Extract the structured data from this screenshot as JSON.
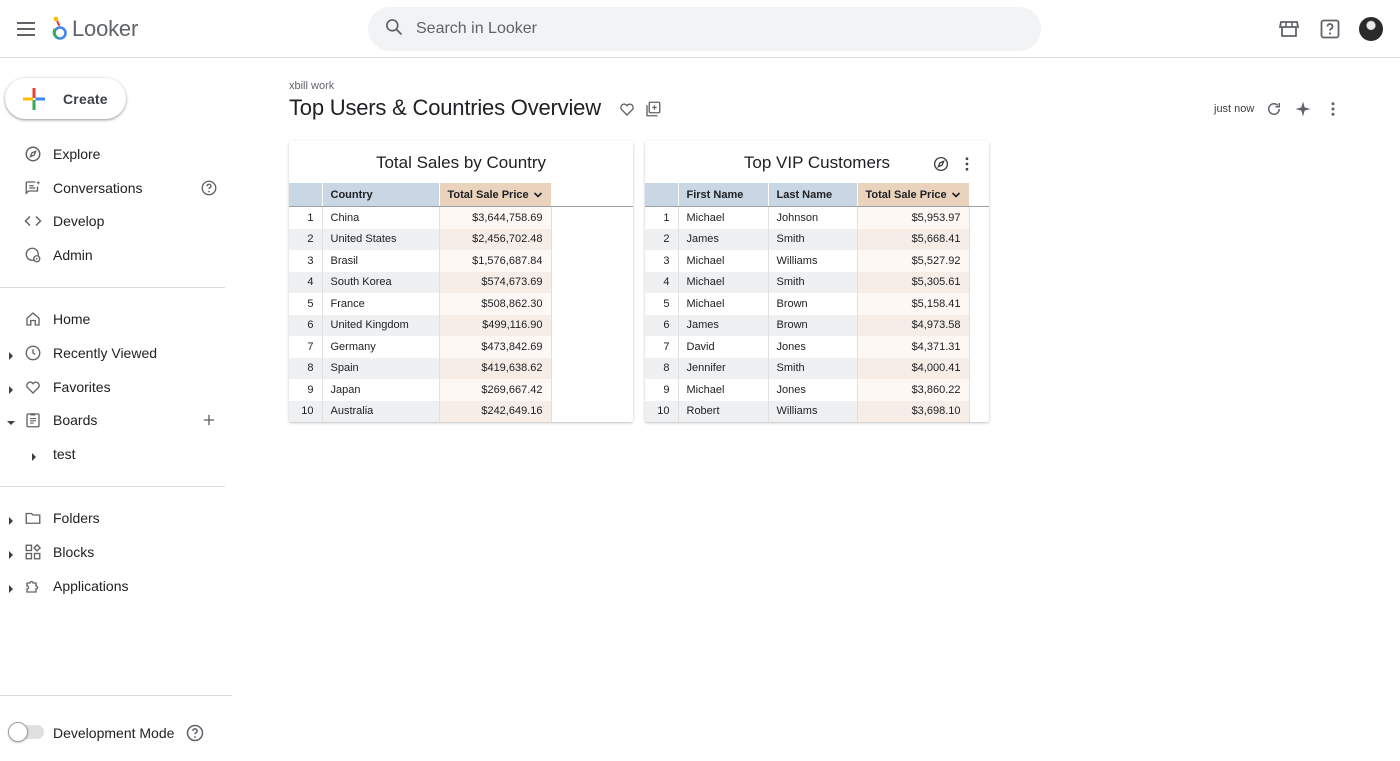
{
  "app": {
    "brand": "Looker",
    "search_placeholder": "Search in Looker"
  },
  "sidebar": {
    "create_label": "Create",
    "primary": [
      {
        "label": "Explore",
        "icon": "compass-icon"
      },
      {
        "label": "Conversations",
        "icon": "conversations-icon"
      },
      {
        "label": "Develop",
        "icon": "code-icon"
      },
      {
        "label": "Admin",
        "icon": "admin-icon"
      }
    ],
    "content": [
      {
        "label": "Home",
        "icon": "home-icon"
      },
      {
        "label": "Recently Viewed",
        "icon": "clock-icon"
      },
      {
        "label": "Favorites",
        "icon": "heart-icon"
      },
      {
        "label": "Boards",
        "icon": "board-icon"
      },
      {
        "label": "test",
        "icon": "caret-right-icon"
      }
    ],
    "library": [
      {
        "label": "Folders",
        "icon": "folder-icon"
      },
      {
        "label": "Blocks",
        "icon": "blocks-icon"
      },
      {
        "label": "Applications",
        "icon": "puzzle-icon"
      }
    ],
    "dev_mode_label": "Development Mode",
    "dev_mode_on": false
  },
  "dashboard": {
    "folder": "xbill work",
    "title": "Top Users & Countries Overview",
    "refreshed": "just now"
  },
  "tiles": {
    "sales": {
      "title": "Total Sales by Country",
      "columns": [
        "Country",
        "Total Sale Price"
      ],
      "rows": [
        [
          "1",
          "China",
          "$3,644,758.69"
        ],
        [
          "2",
          "United States",
          "$2,456,702.48"
        ],
        [
          "3",
          "Brasil",
          "$1,576,687.84"
        ],
        [
          "4",
          "South Korea",
          "$574,673.69"
        ],
        [
          "5",
          "France",
          "$508,862.30"
        ],
        [
          "6",
          "United Kingdom",
          "$499,116.90"
        ],
        [
          "7",
          "Germany",
          "$473,842.69"
        ],
        [
          "8",
          "Spain",
          "$419,638.62"
        ],
        [
          "9",
          "Japan",
          "$269,667.42"
        ],
        [
          "10",
          "Australia",
          "$242,649.16"
        ]
      ]
    },
    "vip": {
      "title": "Top VIP Customers",
      "columns": [
        "First Name",
        "Last Name",
        "Total Sale Price"
      ],
      "rows": [
        [
          "1",
          "Michael",
          "Johnson",
          "$5,953.97"
        ],
        [
          "2",
          "James",
          "Smith",
          "$5,668.41"
        ],
        [
          "3",
          "Michael",
          "Williams",
          "$5,527.92"
        ],
        [
          "4",
          "Michael",
          "Smith",
          "$5,305.61"
        ],
        [
          "5",
          "Michael",
          "Brown",
          "$5,158.41"
        ],
        [
          "6",
          "James",
          "Brown",
          "$4,973.58"
        ],
        [
          "7",
          "David",
          "Jones",
          "$4,371.31"
        ],
        [
          "8",
          "Jennifer",
          "Smith",
          "$4,000.41"
        ],
        [
          "9",
          "Michael",
          "Jones",
          "$3,860.22"
        ],
        [
          "10",
          "Robert",
          "Williams",
          "$3,698.10"
        ]
      ]
    }
  },
  "colors": {
    "dimension_header": "#c9d6e3",
    "measure_header": "#e9d3bd",
    "row_stripe": "#eef0f1",
    "measure_cell": "#f5ede6",
    "divider": "#dadce0"
  }
}
